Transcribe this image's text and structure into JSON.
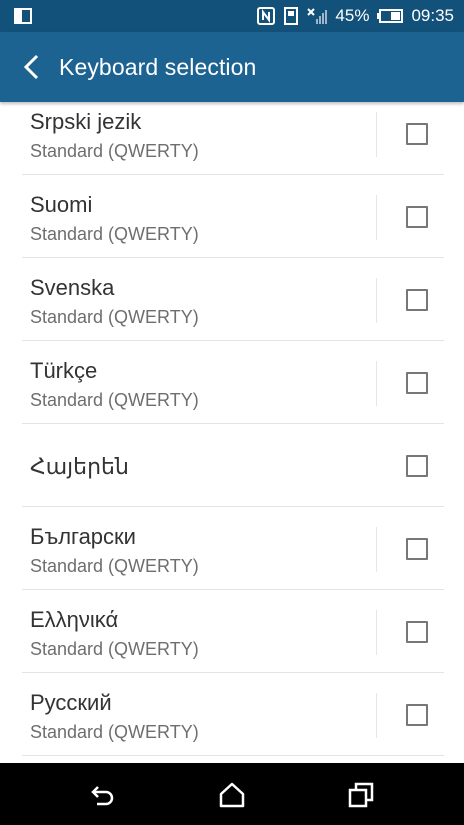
{
  "status_bar": {
    "battery_percent": "45%",
    "time": "09:35",
    "icons": [
      "screen-mirror-icon",
      "nfc-icon",
      "sd-card-icon",
      "no-signal-icon",
      "battery-icon"
    ]
  },
  "app_bar": {
    "title": "Keyboard selection",
    "back_icon": "back-arrow-icon"
  },
  "keyboards": [
    {
      "name": "Srpski jezik",
      "layout": "Standard (QWERTY)",
      "checked": false
    },
    {
      "name": "Suomi",
      "layout": "Standard (QWERTY)",
      "checked": false
    },
    {
      "name": "Svenska",
      "layout": "Standard (QWERTY)",
      "checked": false
    },
    {
      "name": "Türkçe",
      "layout": "Standard (QWERTY)",
      "checked": false
    },
    {
      "name": "Հայերեն",
      "layout": "",
      "checked": false
    },
    {
      "name": "Български",
      "layout": "Standard (QWERTY)",
      "checked": false
    },
    {
      "name": "Ελληνικά",
      "layout": "Standard (QWERTY)",
      "checked": false
    },
    {
      "name": "Русский",
      "layout": "Standard (QWERTY)",
      "checked": false
    }
  ],
  "nav_bar": {
    "icons": [
      "back-icon",
      "home-icon",
      "recents-icon"
    ]
  }
}
